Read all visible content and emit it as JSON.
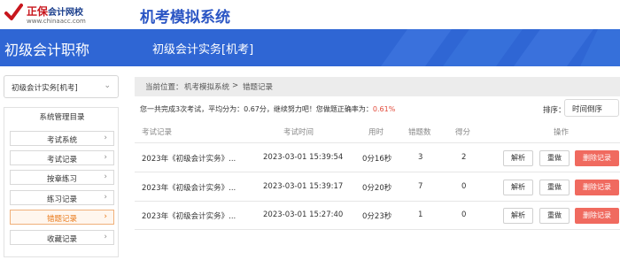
{
  "header": {
    "logo_name": "正保",
    "logo_sub": "会计网校",
    "logo_url": "www.chinaacc.com",
    "app_title": "机考模拟系统"
  },
  "banner": {
    "level": "初级会计职称",
    "course": "初级会计实务[机考]"
  },
  "sidebar": {
    "subject_select": "初级会计实务[机考]",
    "menu_title": "系统管理目录",
    "items": [
      {
        "label": "考试系统",
        "active": false
      },
      {
        "label": "考试记录",
        "active": false
      },
      {
        "label": "按章练习",
        "active": false
      },
      {
        "label": "练习记录",
        "active": false
      },
      {
        "label": "错题记录",
        "active": true
      },
      {
        "label": "收藏记录",
        "active": false
      }
    ]
  },
  "breadcrumb": {
    "prefix": "当前位置：",
    "crumb1": "机考模拟系统",
    "sep": ">",
    "crumb2": "错题记录"
  },
  "summary": {
    "text": "您一共完成3次考试，平均分为：0.67分，继续努力吧！您做题正确率为：",
    "rate": "0.61%"
  },
  "sort": {
    "label": "排序：",
    "value": "时间倒序"
  },
  "table": {
    "headers": {
      "record": "考试记录",
      "time": "考试时间",
      "duration": "用时",
      "wrong": "错题数",
      "score": "得分",
      "action": "操作"
    },
    "rows": [
      {
        "record": "2023年《初级会计实务》...",
        "time": "2023-03-01 15:39:54",
        "duration": "0分16秒",
        "wrong": "3",
        "score": "2"
      },
      {
        "record": "2023年《初级会计实务》...",
        "time": "2023-03-01 15:39:17",
        "duration": "0分20秒",
        "wrong": "7",
        "score": "0"
      },
      {
        "record": "2023年《初级会计实务》...",
        "time": "2023-03-01 15:27:40",
        "duration": "0分23秒",
        "wrong": "1",
        "score": "0"
      }
    ],
    "actions": {
      "analyze": "解析",
      "redo": "重做",
      "delete": "删除记录"
    }
  },
  "colors": {
    "brand_blue": "#2f66d4",
    "title_blue": "#2a55c4",
    "logo_red": "#c8161d",
    "active_orange": "#e97a1b",
    "delete_red": "#f06a5f",
    "rate_red": "#e24b3b"
  },
  "icons": [
    "chinaacc-logo-icon",
    "chevron-down-icon",
    "chevron-right-icon"
  ]
}
